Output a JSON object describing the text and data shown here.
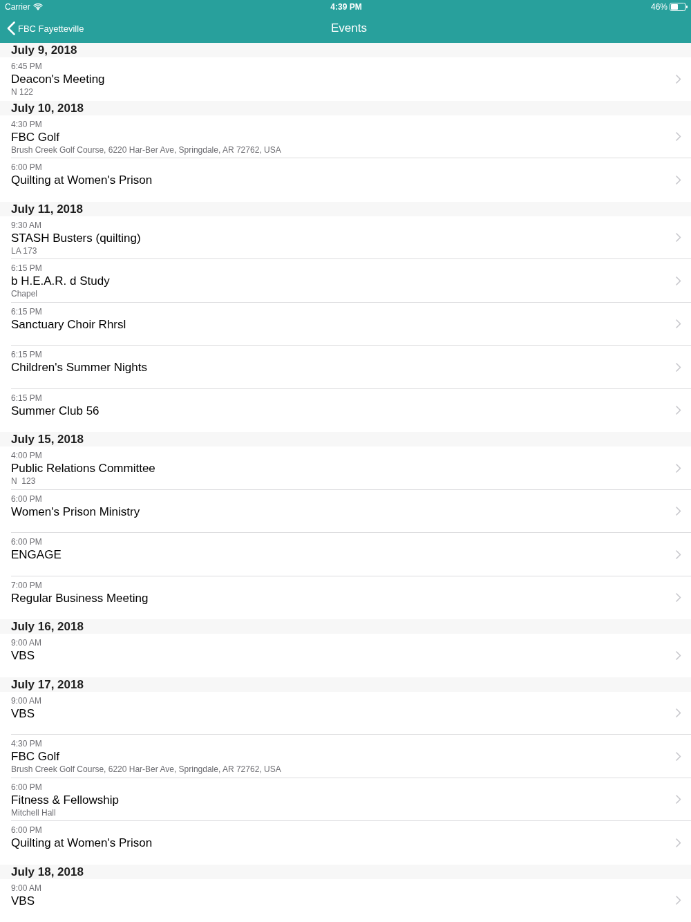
{
  "status_bar": {
    "carrier": "Carrier",
    "time": "4:39 PM",
    "battery": "46%"
  },
  "nav_bar": {
    "back_label": "FBC Fayetteville",
    "title": "Events"
  },
  "sections": [
    {
      "date": "July 9, 2018",
      "events": [
        {
          "time": "6:45 PM",
          "title": "Deacon's Meeting",
          "location": "N 122"
        }
      ]
    },
    {
      "date": "July 10, 2018",
      "events": [
        {
          "time": "4:30 PM",
          "title": "FBC Golf",
          "location": "Brush Creek Golf Course, 6220 Har-Ber Ave, Springdale, AR 72762, USA"
        },
        {
          "time": "6:00 PM",
          "title": "Quilting at Women's Prison"
        }
      ]
    },
    {
      "date": "July 11, 2018",
      "events": [
        {
          "time": "9:30 AM",
          "title": "STASH Busters (quilting)",
          "location": "LA 173"
        },
        {
          "time": "6:15 PM",
          "title": "b H.E.A.R. d Study",
          "location": "Chapel"
        },
        {
          "time": "6:15 PM",
          "title": "Sanctuary Choir Rhrsl"
        },
        {
          "time": "6:15 PM",
          "title": "Children's Summer Nights"
        },
        {
          "time": "6:15 PM",
          "title": "Summer Club 56"
        }
      ]
    },
    {
      "date": "July 15, 2018",
      "events": [
        {
          "time": "4:00 PM",
          "title": "Public Relations Committee",
          "location": "N  123"
        },
        {
          "time": "6:00 PM",
          "title": "Women's Prison Ministry"
        },
        {
          "time": "6:00 PM",
          "title": "ENGAGE"
        },
        {
          "time": "7:00 PM",
          "title": "Regular Business Meeting"
        }
      ]
    },
    {
      "date": "July 16, 2018",
      "events": [
        {
          "time": "9:00 AM",
          "title": "VBS"
        }
      ]
    },
    {
      "date": "July 17, 2018",
      "events": [
        {
          "time": "9:00 AM",
          "title": "VBS"
        },
        {
          "time": "4:30 PM",
          "title": "FBC Golf",
          "location": "Brush Creek Golf Course, 6220 Har-Ber Ave, Springdale, AR 72762, USA"
        },
        {
          "time": "6:00 PM",
          "title": "Fitness & Fellowship",
          "location": "Mitchell Hall"
        },
        {
          "time": "6:00 PM",
          "title": "Quilting at Women's Prison"
        }
      ]
    },
    {
      "date": "July 18, 2018",
      "events": [
        {
          "time": "9:00 AM",
          "title": "VBS"
        }
      ]
    }
  ]
}
